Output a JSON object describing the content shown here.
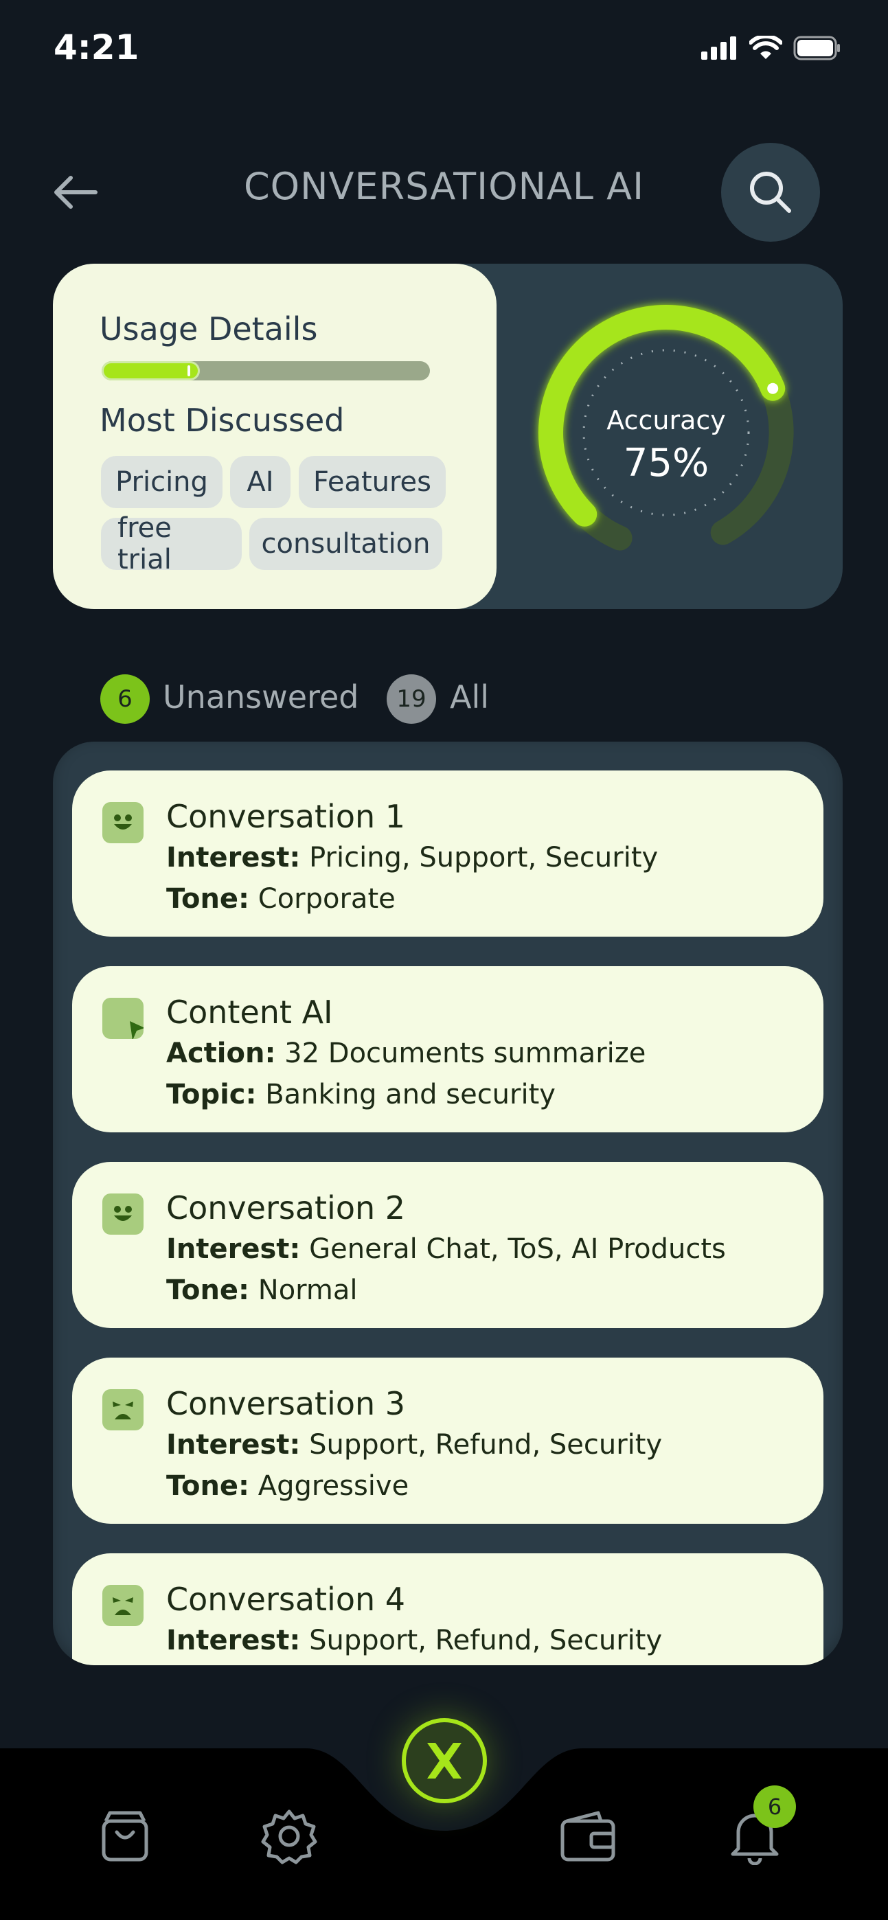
{
  "status": {
    "time": "4:21"
  },
  "header": {
    "title": "CONVERSATIONAL AI"
  },
  "usage": {
    "title": "Usage Details",
    "progress": 0.3,
    "most_discussed_title": "Most Discussed",
    "chips": [
      "Pricing",
      "AI",
      "Features",
      "free trial",
      "consultation"
    ]
  },
  "gauge": {
    "label": "Accuracy",
    "value_text": "75%",
    "value": 0.75
  },
  "tabs": [
    {
      "count": "6",
      "label": "Unanswered",
      "active": true
    },
    {
      "count": "19",
      "label": "All",
      "active": false
    }
  ],
  "cards": [
    {
      "icon": "smile-icon",
      "title": "Conversation 1",
      "l1k": "Interest:",
      "l1v": " Pricing, Support, Security",
      "l2k": "Tone:",
      "l2v": " Corporate"
    },
    {
      "icon": "chat-bubble-icon",
      "title": "Content AI",
      "l1k": "Action:",
      "l1v": " 32 Documents summarize",
      "l2k": "Topic:",
      "l2v": " Banking and security"
    },
    {
      "icon": "smile-icon",
      "title": "Conversation 2",
      "l1k": "Interest:",
      "l1v": "  General Chat, ToS, AI Products",
      "l2k": "Tone:",
      "l2v": " Normal"
    },
    {
      "icon": "angry-icon",
      "title": "Conversation 3",
      "l1k": "Interest:",
      "l1v": " Support, Refund, Security",
      "l2k": "Tone:",
      "l2v": " Aggressive"
    },
    {
      "icon": "angry-icon",
      "title": "Conversation 4",
      "l1k": "Interest:",
      "l1v": " Support, Refund, Security",
      "l2k": "",
      "l2v": ""
    }
  ],
  "nav": {
    "notifications_count": "6"
  },
  "colors": {
    "accent": "#a6e51a",
    "background": "#111820",
    "panel": "#2c3f4a",
    "card": "#f5fbe3"
  }
}
